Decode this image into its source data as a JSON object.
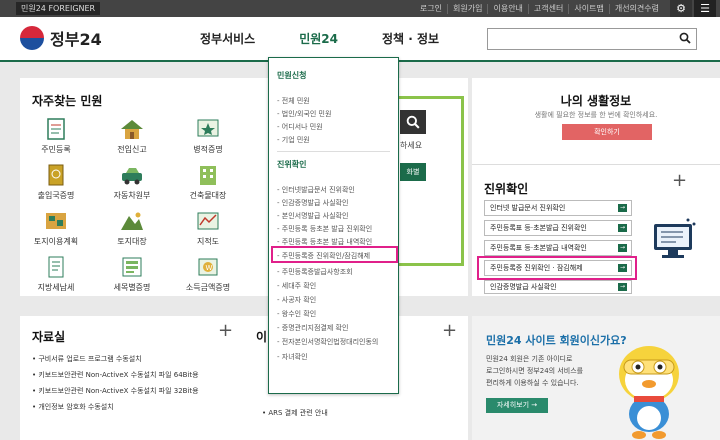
{
  "topbar": {
    "lang": "민원24 FOREIGNER",
    "links": [
      "로그인",
      "회원가입",
      "이용안내",
      "고객센터",
      "사이트맵",
      "개선의견수렴"
    ]
  },
  "header": {
    "logo_text": "정부24",
    "nav": [
      "정부서비스",
      "민원24",
      "정책 · 정보"
    ],
    "active_nav": "민원24",
    "search_placeholder": "",
    "brand_color": "#1b6b4a",
    "highlight_color": "#e0208a"
  },
  "frequent": {
    "title": "자주찾는 민원",
    "items": [
      "주민등록",
      "전입신고",
      "병적증명",
      "출입국증명",
      "자동차원부",
      "건축물대장",
      "토지이용계획",
      "토지대장",
      "지적도",
      "지방세납세",
      "세목별증명",
      "소득금액증명"
    ]
  },
  "middle_peek": {
    "text1": "하세요",
    "text2": "화별"
  },
  "dropdown": {
    "sections": [
      {
        "title": "민원신청",
        "items": [
          "전체 민원",
          "법인/외국인 민원",
          "어디서나 민원",
          "기업 민원"
        ]
      },
      {
        "title": "진위확인",
        "items": [
          "인터넷발급문서 진위확인",
          "인감증명발급 사실확인",
          "본인서명발급 사실확인",
          "주민등록 등초본 발급 진위확인",
          "주민등록 등초본 발급 내역확인",
          "주민등록증 진위확인/잠김해제",
          "주민등록증발급사항조회",
          "세대주 확인",
          "사공자 확인",
          "왕수인 확인",
          "증명관리지점결제 확인",
          "전자본인서명확인법정대리인동의",
          "자녀확인"
        ]
      }
    ],
    "highlighted": "주민등록증 진위확인/잠김해제"
  },
  "life": {
    "title": "나의 생활정보",
    "desc": "생활에 필요한 정보를 한 번에 확인하세요.",
    "button": "확인하기"
  },
  "verify": {
    "title": "진위확인",
    "items": [
      "인터넷 발급문서 진위확인",
      "주민등록표 등·초본발급 진위확인",
      "주민등록표 등·초본발급 내역확인",
      "주민등록증 진위확인 · 잠김해제",
      "인감증명발급 사실확인"
    ],
    "highlighted_index": 3
  },
  "resources": {
    "title": "자료실",
    "items": [
      "구비서류 업로드 프로그램 수동설치",
      "키보드보안관련 Non-ActiveX 수동설치 파일 64Bit용",
      "키보드보안관련 Non-ActiveX 수동설치 파일 32Bit용",
      "개인정보 암호화 수동설치"
    ]
  },
  "notice": {
    "title": "이",
    "items": [
      "ARS 결제 관련 안내"
    ]
  },
  "promo": {
    "title": "민원24 사이트 회원이신가요?",
    "desc": [
      "민원24 회원은 기존 아이디로",
      "로그인하시면 정부24의 서비스를",
      "편리하게 이용하실 수 있습니다."
    ],
    "button": "자세히보기 →"
  }
}
